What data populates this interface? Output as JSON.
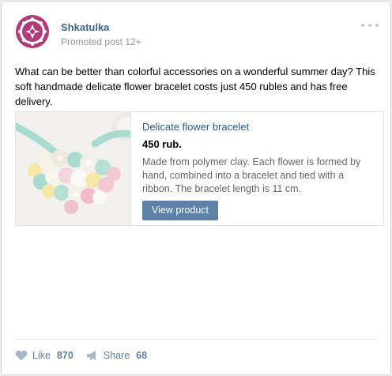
{
  "post": {
    "author": "Shkatulka",
    "subtitle": "Promoted post 12+",
    "text": "What can be better than colorful accessories on a wonderful summer day? This soft handmade delicate flower bracelet costs just 450 rubles and has free delivery."
  },
  "product": {
    "title": "Delicate flower bracelet",
    "price": "450 rub.",
    "description": "Made from polymer clay. Each flower is formed by hand, combined into a bracelet and tied with a ribbon. The bracelet length is 11 cm.",
    "button_label": "View product"
  },
  "actions": {
    "like_label": "Like",
    "like_count": "870",
    "share_label": "Share",
    "share_count": "68"
  },
  "icons": {
    "more": "more-dots-icon",
    "like": "heart-icon",
    "share": "megaphone-icon"
  },
  "colors": {
    "link": "#42648b",
    "button": "#5e81a8",
    "action": "#5e81a8",
    "avatar_accent": "#b03a7a"
  }
}
